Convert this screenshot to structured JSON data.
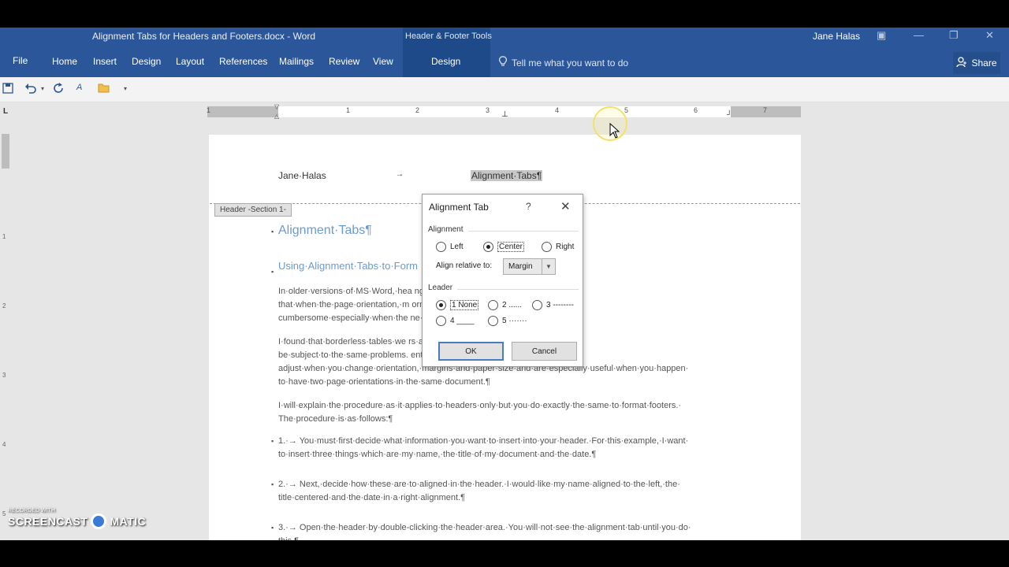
{
  "window": {
    "title": "Alignment Tabs for Headers and Footers.docx - Word",
    "context_tools": "Header & Footer Tools",
    "user": "Jane Halas"
  },
  "ribbon": {
    "file": "File",
    "tabs": [
      "Home",
      "Insert",
      "Design",
      "Layout",
      "References",
      "Mailings",
      "Review",
      "View"
    ],
    "context_tab": "Design",
    "tell_me": "Tell me what you want to do",
    "share": "Share"
  },
  "ruler": {
    "numbers": [
      "1",
      "1",
      "2",
      "3",
      "4",
      "5",
      "6",
      "7"
    ]
  },
  "vruler": {
    "numbers": [
      "1",
      "2",
      "3",
      "4",
      "5"
    ]
  },
  "document": {
    "header_left": "Jane·Halas",
    "header_arrow": "→",
    "header_center": "Alignment·Tabs¶",
    "header_tag": "Header -Section 1-",
    "heading1": "Alignment·Tabs¶",
    "heading2": "Using·Alignment·Tabs·to·Form",
    "para1": [
      "In·older·versions·of·MS·Word,·hea                                          ng·tabs.·The·problem·with·them·is·",
      "that·when·the·page·orientation,·m                                          ormat·changes.·This·can·be·",
      "cumbersome·especially·when·the                                             ne·same·document.¶"
    ],
    "para2": [
      "I·found·that·borderless·tables·we                                          rs·and·footer,·but·they,·too,·can·",
      "be·subject·to·the·same·problems.                                           ent·Tabs.·They·automatically·",
      "adjust·when·you·change·orientation,·margins·and·paper·size·and·are·especially·useful·when·you·happen·",
      "to·have·two·page·orientations·in·the·same·document.¶"
    ],
    "para3": [
      "I·will·explain·the·procedure·as·it·applies·to·headers·only·but·you·do·exactly·the·same·to·format·footers.·",
      "The·procedure·is·as·follows:¶"
    ],
    "list": [
      [
        "1.·→ You·must·first·decide·what·information·you·want·to·insert·into·your·header.·For·this·example,·I·want·",
        "      to·insert·three·things·which·are·my·name,·the·title·of·my·document·and·the·date.¶"
      ],
      [
        "2.·→ Next,·decide·how·these·are·to·aligned·in·the·header.·I·would·like·my·name·aligned·to·the·left,·the·",
        "      title·centered·and·the·date·in·a·right·alignment.¶"
      ],
      [
        "3.·→ Open·the·header·by·double-clicking·the·header·area.·You·will·not·see·the·alignment·tab·until·you·do·",
        "      this.¶"
      ]
    ]
  },
  "dialog": {
    "title": "Alignment Tab",
    "help": "?",
    "alignment_label": "Alignment",
    "alignment_options": [
      "Left",
      "Center",
      "Right"
    ],
    "alignment_selected": "Center",
    "relative_label": "Align relative to:",
    "relative_value": "Margin",
    "leader_label": "Leader",
    "leader_options": [
      "1 None",
      "2 ......",
      "3 --------",
      "4 ____",
      "5 ·······"
    ],
    "leader_selected": "1 None",
    "ok": "OK",
    "cancel": "Cancel"
  },
  "watermark": {
    "line1": "RECORDED WITH",
    "left": "SCREENCAST",
    "right": "MATIC"
  }
}
